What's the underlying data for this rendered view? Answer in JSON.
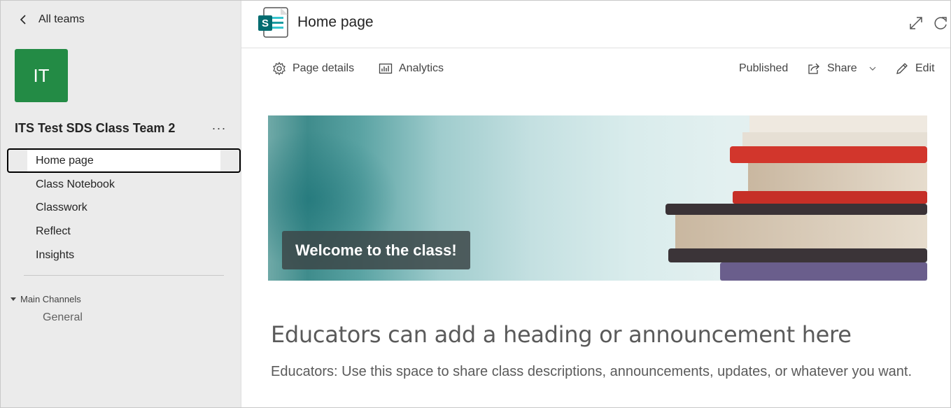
{
  "sidebar": {
    "back_label": "All teams",
    "avatar_initials": "IT",
    "avatar_color": "#238b45",
    "team_name": "ITS Test SDS Class Team 2",
    "more_label": "···",
    "items": [
      {
        "label": "Home page",
        "selected": true
      },
      {
        "label": "Class Notebook",
        "selected": false
      },
      {
        "label": "Classwork",
        "selected": false
      },
      {
        "label": "Reflect",
        "selected": false
      },
      {
        "label": "Insights",
        "selected": false
      }
    ],
    "section_label": "Main Channels",
    "channels": [
      "General"
    ]
  },
  "header": {
    "title": "Home page",
    "app_icon": "sharepoint-icon",
    "icons": [
      "expand-icon",
      "refresh-icon"
    ]
  },
  "commandbar": {
    "page_details_label": "Page details",
    "analytics_label": "Analytics",
    "status_label": "Published",
    "share_label": "Share",
    "edit_label": "Edit"
  },
  "hero": {
    "caption": "Welcome to the class!"
  },
  "content": {
    "heading": "Educators can add a heading or announcement here",
    "body": "Educators: Use this space to share class descriptions, announcements, updates, or whatever you want."
  },
  "colors": {
    "sharepoint_brand": "#038387",
    "sidebar_bg": "#ebebeb"
  }
}
